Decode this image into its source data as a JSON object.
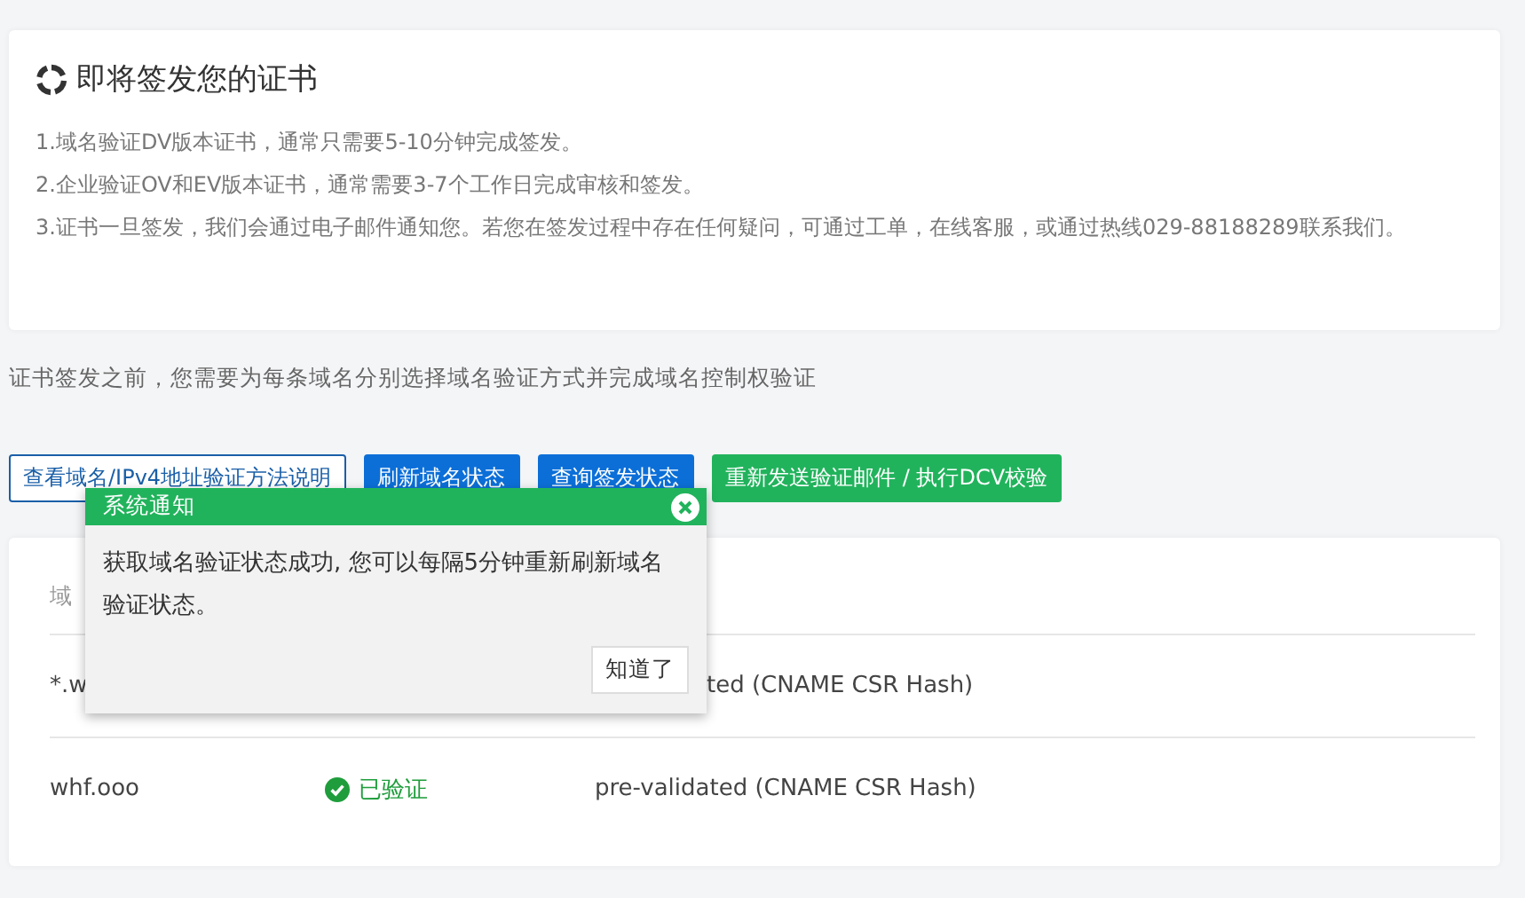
{
  "header_card": {
    "title": "即将签发您的证书",
    "notes": [
      "1.域名验证DV版本证书，通常只需要5-10分钟完成签发。",
      "2.企业验证OV和EV版本证书，通常需要3-7个工作日完成审核和签发。",
      "3.证书一旦签发，我们会通过电子邮件通知您。若您在签发过程中存在任何疑问，可通过工单，在线客服，或通过热线029-88188289联系我们。"
    ]
  },
  "intro": "证书签发之前，您需要为每条域名分别选择域名验证方式并完成域名控制权验证",
  "buttons": [
    {
      "label": "查看域名/IPv4地址验证方法说明",
      "kind": "outline"
    },
    {
      "label": "刷新域名状态",
      "kind": "primary"
    },
    {
      "label": "查询签发状态",
      "kind": "primary"
    },
    {
      "label": "重新发送验证邮件 / 执行DCV校验",
      "kind": "success"
    }
  ],
  "table": {
    "columns": [
      "域"
    ],
    "rows": [
      {
        "domain": "*.w",
        "method": "ted (CNAME CSR Hash)"
      },
      {
        "domain": "whf.ooo",
        "status": "已验证",
        "verified": true,
        "method": "pre-validated (CNAME CSR Hash)"
      }
    ]
  },
  "dialog": {
    "title": "系统通知",
    "message": "获取域名验证状态成功, 您可以每隔5分钟重新刷新域名验证状态。",
    "button": "知道了"
  }
}
